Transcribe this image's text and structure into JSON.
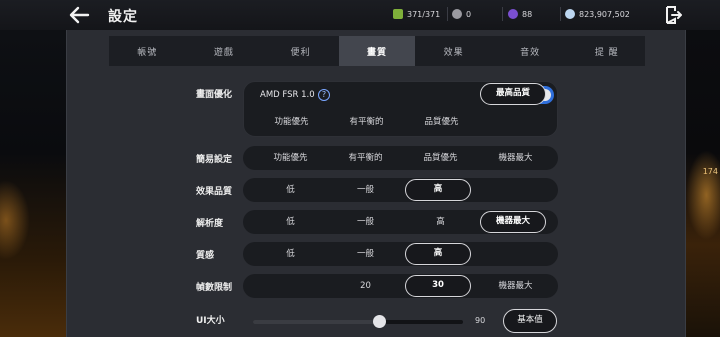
{
  "header": {
    "title": "設定",
    "resources": [
      {
        "icon": "stamina-icon",
        "color": "#7fb03a",
        "value": "371/371"
      },
      {
        "icon": "silver-coin-icon",
        "color": "#9a9aa0",
        "value": "0"
      },
      {
        "icon": "purple-gem-icon",
        "color": "#7a4fd0",
        "value": "88"
      },
      {
        "icon": "diamond-icon",
        "color": "#bcd6f0",
        "value": "823,907,502"
      }
    ]
  },
  "tabs": [
    {
      "label": "帳號",
      "active": false
    },
    {
      "label": "遊戲",
      "active": false
    },
    {
      "label": "便利",
      "active": false
    },
    {
      "label": "畫質",
      "active": true
    },
    {
      "label": "效果",
      "active": false
    },
    {
      "label": "音效",
      "active": false
    },
    {
      "label": "提 醒",
      "active": false
    }
  ],
  "settings": {
    "quality_opt": {
      "label": "畫面優化",
      "fsr_title": "AMD FSR 1.0",
      "help": "?",
      "toggle": "ON",
      "options": [
        "功能優先",
        "有平衡的",
        "品質優先",
        "最高品質"
      ],
      "selected": 3
    },
    "simple": {
      "label": "簡易設定",
      "options": [
        "功能優先",
        "有平衡的",
        "品質優先",
        "機器最大"
      ],
      "selected": -1
    },
    "effect": {
      "label": "效果品質",
      "options": [
        "低",
        "一般",
        "高"
      ],
      "selected": 2
    },
    "resolution": {
      "label": "解析度",
      "options": [
        "低",
        "一般",
        "高",
        "機器最大"
      ],
      "selected": 3
    },
    "texture": {
      "label": "質感",
      "options": [
        "低",
        "一般",
        "高"
      ],
      "selected": 2
    },
    "fps": {
      "label": "幀數限制",
      "options": [
        "20",
        "30",
        "機器最大"
      ],
      "selected": 1
    },
    "ui_size": {
      "label": "UI大小",
      "value": "90",
      "fraction": 0.6,
      "reset_label": "基本值"
    }
  },
  "side_text": "174"
}
